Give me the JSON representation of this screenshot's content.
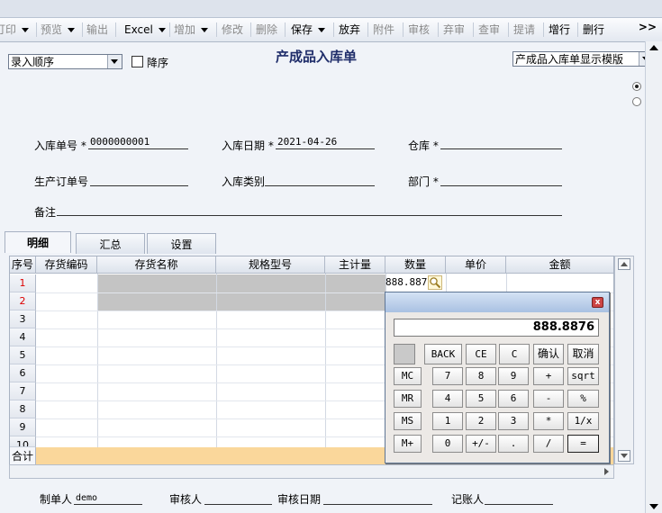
{
  "toolbar": {
    "items": [
      {
        "label": "打印",
        "shown": "打印",
        "dropdown": true,
        "enabled": false
      },
      {
        "label": "预览",
        "dropdown": true,
        "enabled": false
      },
      {
        "label": "输出",
        "enabled": false
      },
      {
        "label": "Excel",
        "dropdown": true,
        "enabled": true
      },
      {
        "label": "增加",
        "dropdown": true,
        "enabled": false
      },
      {
        "label": "修改",
        "enabled": false
      },
      {
        "label": "删除",
        "enabled": false
      },
      {
        "label": "保存",
        "dropdown": true,
        "enabled": true
      },
      {
        "label": "放弃",
        "enabled": true
      },
      {
        "label": "附件",
        "enabled": false
      },
      {
        "label": "审核",
        "enabled": false
      },
      {
        "label": "弃审",
        "enabled": false
      },
      {
        "label": "查审",
        "enabled": false
      },
      {
        "label": "提请",
        "enabled": false
      },
      {
        "label": "增行",
        "enabled": true
      },
      {
        "label": "删行",
        "enabled": true
      }
    ],
    "more": ">>"
  },
  "sort": {
    "selected": "录入顺序",
    "descending_label": "降序"
  },
  "form": {
    "title": "产成品入库单",
    "template": "产成品入库单显示模版",
    "fields": {
      "receipt_no_label": "入库单号",
      "receipt_no": "0000000001",
      "date_label": "入库日期",
      "date": "2021-04-26",
      "warehouse_label": "仓库",
      "warehouse": "",
      "order_no_label": "生产订单号",
      "order_no": "",
      "category_label": "入库类别",
      "category": "",
      "dept_label": "部门",
      "dept": "",
      "remark_label": "备注",
      "remark": ""
    },
    "required_mark": "*"
  },
  "tabs": [
    "明细",
    "汇总",
    "设置"
  ],
  "grid": {
    "columns": [
      "序号",
      "存货编码",
      "存货名称",
      "规格型号",
      "主计量",
      "数量",
      "单价",
      "金额"
    ],
    "row_numbers": [
      "1",
      "2",
      "3",
      "4",
      "5",
      "6",
      "7",
      "8",
      "9",
      "10"
    ],
    "row1_quantity": "888.887",
    "total_label": "合计"
  },
  "calculator": {
    "display": "888.8876",
    "close": "x",
    "top_buttons": [
      "BACK",
      "CE",
      "C",
      "确认",
      "取消"
    ],
    "rows": [
      [
        "MC",
        "7",
        "8",
        "9",
        "+",
        "sqrt"
      ],
      [
        "MR",
        "4",
        "5",
        "6",
        "-",
        "%"
      ],
      [
        "MS",
        "1",
        "2",
        "3",
        "*",
        "1/x"
      ],
      [
        "M+",
        "0",
        "+/-",
        ".",
        "/",
        "="
      ]
    ]
  },
  "footer": {
    "maker_label": "制单人",
    "maker": "demo",
    "reviewer_label": "审核人",
    "reviewer": "",
    "review_date_label": "审核日期",
    "review_date": "",
    "bookkeeper_label": "记账人",
    "bookkeeper": ""
  }
}
